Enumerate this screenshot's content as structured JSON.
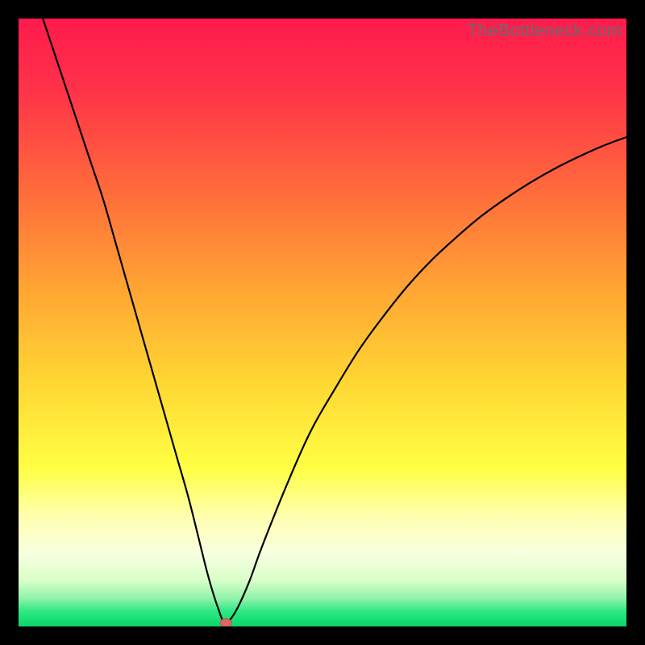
{
  "watermark": "TheBottleneck.com",
  "colors": {
    "frame_bg": "#000000",
    "curve": "#000000",
    "marker_fill": "#e06666",
    "marker_stroke": "#c24d4d",
    "gradient_stops": [
      {
        "offset": 0.0,
        "color": "#ff1a4d"
      },
      {
        "offset": 0.12,
        "color": "#ff3348"
      },
      {
        "offset": 0.28,
        "color": "#ff6a3c"
      },
      {
        "offset": 0.45,
        "color": "#ffa733"
      },
      {
        "offset": 0.6,
        "color": "#ffd733"
      },
      {
        "offset": 0.74,
        "color": "#ffff44"
      },
      {
        "offset": 0.82,
        "color": "#ffffb0"
      },
      {
        "offset": 0.88,
        "color": "#f7ffe0"
      },
      {
        "offset": 0.925,
        "color": "#d8ffc8"
      },
      {
        "offset": 0.955,
        "color": "#8cf2a8"
      },
      {
        "offset": 0.975,
        "color": "#2ee884"
      },
      {
        "offset": 1.0,
        "color": "#08d66a"
      }
    ]
  },
  "chart_data": {
    "type": "line",
    "title": "",
    "xlabel": "",
    "ylabel": "",
    "xlim": [
      0,
      100
    ],
    "ylim": [
      0,
      100
    ],
    "series": [
      {
        "name": "bottleneck-curve",
        "x": [
          4,
          6,
          8,
          10,
          12,
          14,
          16,
          18,
          20,
          22,
          24,
          26,
          28,
          30,
          31,
          32,
          33,
          33.7,
          34.5,
          36,
          38,
          40,
          44,
          48,
          52,
          56,
          60,
          64,
          68,
          72,
          76,
          80,
          84,
          88,
          92,
          96,
          100
        ],
        "y": [
          100,
          94,
          88,
          82,
          76,
          70,
          63,
          56,
          49,
          42,
          35,
          28,
          21,
          13,
          9,
          5.5,
          2.5,
          0.8,
          0.8,
          3,
          7.5,
          13,
          23,
          32,
          39,
          45.5,
          51,
          56,
          60.3,
          64,
          67.4,
          70.3,
          72.9,
          75.2,
          77.2,
          79,
          80.5
        ]
      }
    ],
    "marker": {
      "x": 34.1,
      "y": 0.6
    }
  }
}
